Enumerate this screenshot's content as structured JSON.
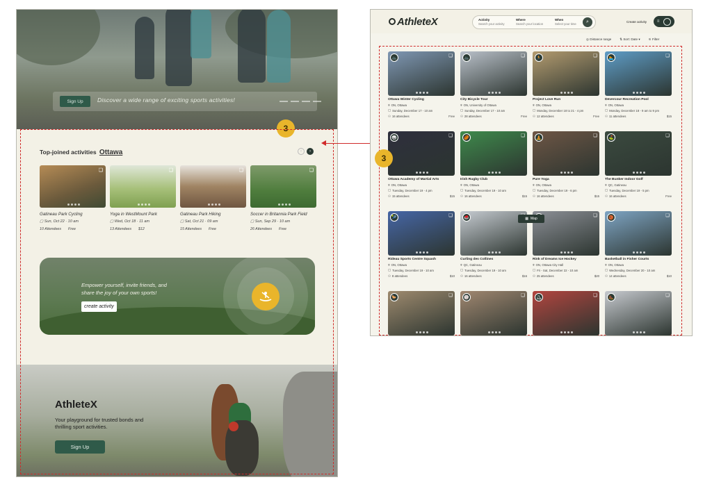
{
  "left": {
    "hero": {
      "signup_label": "Sign Up",
      "tagline": "Discover a wide range of exciting sports activities!"
    },
    "badge": "3",
    "section": {
      "title": "Top-joined activities",
      "city": "Ottawa",
      "prev": "‹",
      "next": "›"
    },
    "cards": [
      {
        "name": "Gatineau Park Cycling",
        "date": "Sun, Oct 22  ·  10 am",
        "attendees": "10 Attendees",
        "price": "Free",
        "color": "#8a6a44"
      },
      {
        "name": "Yoga in WestMount Park",
        "date": "Wed, Oct 18  ·  11 am",
        "attendees": "13 Attendees",
        "price": "$12",
        "color": "#8fa868"
      },
      {
        "name": "Gatineau Park Hiking",
        "date": "Sat, Oct 21  ·  09 am",
        "attendees": "15 Attendees",
        "price": "Free",
        "color": "#7c6650"
      },
      {
        "name": "Soccer in Britannia Park Field",
        "date": "Sun, Sep 29  ·  10 am",
        "attendees": "26 Attendees",
        "price": "Free",
        "color": "#5f8c4c"
      }
    ],
    "banner": {
      "text": "Empower yourself, invite friends, and share the joy of your own sports!",
      "button": "create activity"
    },
    "footer": {
      "brand": "AthleteX",
      "tagline": "Your playground for trusted  bonds and thrilling sport activities.",
      "signup_label": "Sign Up"
    }
  },
  "right": {
    "logo": "AthleteX",
    "search": {
      "activity_label": "Activity",
      "activity_hint": "Search your activity",
      "where_label": "Where",
      "where_hint": "Search your location",
      "when_label": "When",
      "when_hint": "Select your time"
    },
    "create_label": "Create activity",
    "filters": {
      "distance": "Distance range",
      "sort_label": "Sort:",
      "sort_value": "Date",
      "filter": "Filter"
    },
    "badge": "3",
    "map_label": "Map",
    "cards": [
      {
        "title": "Ottawa Winter Cycling",
        "loc": "ON, Ottawa",
        "date": "Sunday, December 17 - 10 am",
        "att": "16 attendees",
        "price": "Free",
        "color": "#7f97b3",
        "icon": "🚲"
      },
      {
        "title": "City Bicycle Tour",
        "loc": "ON, University of Ottawa",
        "date": "Sunday, December 17 - 10 am",
        "att": "28 attendees",
        "price": "Free",
        "color": "#b9c0c9",
        "icon": "🚲"
      },
      {
        "title": "Project Love Run",
        "loc": "ON, Ottawa",
        "date": "Monday, December 18 to 21 - 4 pm",
        "att": "12 attendees",
        "price": "Free",
        "color": "#b39b6f",
        "icon": "🏃"
      },
      {
        "title": "Devercour Recreation Pool",
        "loc": "ON, Ottawa",
        "date": "Monday, December 18 - 9 am to 9 pm",
        "att": "11 attendees",
        "price": "$15",
        "color": "#5e9cc6",
        "icon": "🏊"
      },
      {
        "title": "Ottawa Academy of Martial Arts",
        "loc": "ON, Ottawa",
        "date": "Tuesday, December 19 - 4 pm",
        "att": "15 attendees",
        "price": "$15",
        "color": "#2e2f3d",
        "icon": "🥋"
      },
      {
        "title": "Irish Rugby Club",
        "loc": "ON, Ottawa",
        "date": "Tuesday, December 19 - 10 am",
        "att": "16 attendees",
        "price": "$15",
        "color": "#3f8a4c",
        "icon": "🏉"
      },
      {
        "title": "Pure Yoga",
        "loc": "ON, Ottawa",
        "date": "Tuesday, December 19 - 6 pm",
        "att": "16 attendees",
        "price": "$15",
        "color": "#6e5645",
        "icon": "🧘"
      },
      {
        "title": "The Bunker Indoor Golf",
        "loc": "QC, Gatineau",
        "date": "Tuesday, December 19 - 5 pm",
        "att": "16 attendees",
        "price": "Free",
        "color": "#3b4a3f",
        "icon": "⛳"
      },
      {
        "title": "Rideau Sports Centre Squash",
        "loc": "ON, Ottawa",
        "date": "Tuesday, December 19 - 10 am",
        "att": "8 attendees",
        "price": "$10",
        "color": "#4666a6",
        "icon": "🎾"
      },
      {
        "title": "Curling des Collines",
        "loc": "QC, Gatineau",
        "date": "Tuesday, December 19 - 10 am",
        "att": "16 attendees",
        "price": "$16",
        "color": "#c6cbd1",
        "icon": "🥌"
      },
      {
        "title": "Rink of Dreams Ice Hockey",
        "loc": "ON, Ottawa City Hall",
        "date": "Fri - Sat, December 22 - 10 am",
        "att": "25 attendees",
        "price": "$20",
        "color": "#8c8f96",
        "icon": "🏒"
      },
      {
        "title": "Basketball in Fisher Courts",
        "loc": "ON, Ottawa",
        "date": "Wednesday, December 20 - 10 am",
        "att": "14 attendees",
        "price": "$10",
        "color": "#7ea4c3",
        "icon": "🏀"
      },
      {
        "title": "",
        "loc": "",
        "date": "",
        "att": "",
        "price": "",
        "color": "#9e8a6e",
        "icon": "🐎"
      },
      {
        "title": "",
        "loc": "",
        "date": "",
        "att": "",
        "price": "",
        "color": "#a08770",
        "icon": "🏐"
      },
      {
        "title": "",
        "loc": "",
        "date": "",
        "att": "",
        "price": "",
        "color": "#b2453f",
        "icon": "⛸"
      },
      {
        "title": "",
        "loc": "",
        "date": "",
        "att": "",
        "price": "",
        "color": "#c6c9ce",
        "icon": "🥾"
      }
    ]
  }
}
